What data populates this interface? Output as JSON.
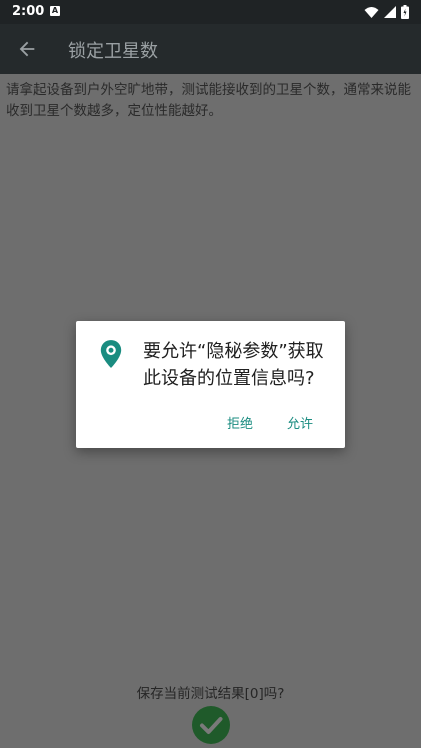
{
  "status_bar": {
    "time": "2:00",
    "notification_glyph": "A",
    "icons": [
      "wifi-icon",
      "signal-icon",
      "battery-icon"
    ]
  },
  "toolbar": {
    "title": "锁定卫星数",
    "back_icon": "arrow-left-icon"
  },
  "content": {
    "instruction": "请拿起设备到户外空旷地带，测试能接收到的卫星个数，通常来说能收到卫星个数越多，定位性能越好。"
  },
  "dialog": {
    "icon": "location-pin-icon",
    "message": "要允许“隐秘参数”获取此设备的位置信息吗?",
    "deny_label": "拒绝",
    "allow_label": "允许"
  },
  "footer": {
    "save_prompt": "保存当前测试结果[0]吗?",
    "confirm_icon": "check-icon"
  },
  "colors": {
    "accent": "#1a8c80",
    "toolbar": "#252a2c",
    "confirm": "#2e8b3e"
  }
}
